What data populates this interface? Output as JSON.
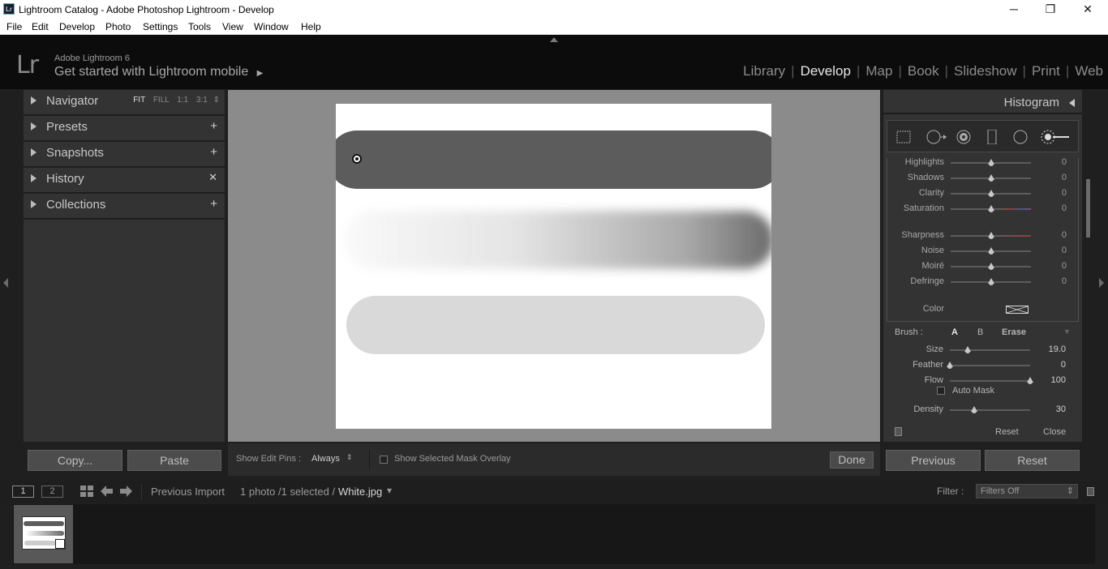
{
  "window": {
    "title": "Lightroom Catalog - Adobe Photoshop Lightroom - Develop",
    "app_icon": "Lr",
    "minimize": "─",
    "restore": "❐",
    "close": "✕"
  },
  "menu": [
    "File",
    "Edit",
    "Develop",
    "Photo",
    "Settings",
    "Tools",
    "View",
    "Window",
    "Help"
  ],
  "identity": {
    "logo": "Lr",
    "brand": "Adobe Lightroom 6",
    "get_started": "Get started with Lightroom mobile",
    "get_started_arrow": "▶"
  },
  "modules": {
    "items": [
      "Library",
      "Develop",
      "Map",
      "Book",
      "Slideshow",
      "Print",
      "Web"
    ],
    "active": "Develop",
    "separator": "|"
  },
  "left_panel": {
    "navigator": {
      "label": "Navigator",
      "zoom": [
        "FIT",
        "FILL",
        "1:1",
        "3:1"
      ],
      "zoom_selected": "FIT",
      "zoom_arrows": "⇕"
    },
    "presets": {
      "label": "Presets",
      "action": "+"
    },
    "snapshots": {
      "label": "Snapshots",
      "action": "+"
    },
    "history": {
      "label": "History",
      "action": "✕"
    },
    "collections": {
      "label": "Collections",
      "action": "+"
    }
  },
  "left_buttons": {
    "copy": "Copy...",
    "paste": "Paste"
  },
  "toolbar": {
    "show_edit_pins_label": "Show Edit Pins :",
    "show_edit_pins_value": "Always",
    "updown": "⇕",
    "show_mask_overlay": "Show Selected Mask Overlay",
    "show_mask_overlay_checked": false,
    "done": "Done"
  },
  "right_panel": {
    "histogram": "Histogram",
    "sliders": [
      {
        "label": "Highlights",
        "value": "0",
        "pos": 0.5
      },
      {
        "label": "Shadows",
        "value": "0",
        "pos": 0.5
      },
      {
        "label": "Clarity",
        "value": "0",
        "pos": 0.5
      },
      {
        "label": "Saturation",
        "value": "0",
        "pos": 0.5
      },
      {
        "label": "Sharpness",
        "value": "0",
        "pos": 0.5
      },
      {
        "label": "Noise",
        "value": "0",
        "pos": 0.5
      },
      {
        "label": "Moiré",
        "value": "0",
        "pos": 0.5
      },
      {
        "label": "Defringe",
        "value": "0",
        "pos": 0.5
      }
    ],
    "color_label": "Color",
    "brush": {
      "label": "Brush :",
      "a": "A",
      "b": "B",
      "erase": "Erase",
      "dropdown": "▼",
      "size": {
        "label": "Size",
        "value": "19.0",
        "pos": 0.22
      },
      "feather": {
        "label": "Feather",
        "value": "0",
        "pos": 0.0
      },
      "flow": {
        "label": "Flow",
        "value": "100",
        "pos": 1.0
      },
      "auto_mask": "Auto Mask",
      "auto_mask_checked": false,
      "density": {
        "label": "Density",
        "value": "30",
        "pos": 0.3
      }
    },
    "reset": "Reset",
    "close": "Close"
  },
  "right_buttons": {
    "previous": "Previous",
    "reset": "Reset"
  },
  "filmstrip_bar": {
    "screen1": "1",
    "screen2": "2",
    "source": "Previous Import",
    "count": "1 photo /1 selected /",
    "filename": "White.jpg",
    "filename_arrow": "▾",
    "filter_label": "Filter :",
    "filter_value": "Filters Off",
    "filter_arrows": "⇕"
  },
  "colors": {
    "panel_bg": "#333333",
    "canvas_bg": "#8b8b8b",
    "active_module": "#e6e6e6",
    "inactive_module": "#8c8c8c"
  }
}
